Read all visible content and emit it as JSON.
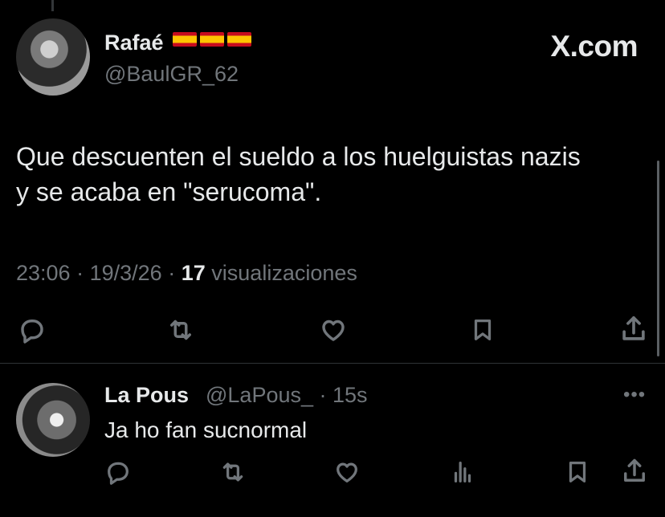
{
  "tweet": {
    "author_name": "Rafaé",
    "author_flags": [
      "🇪🇸",
      "🇪🇸",
      "🇪🇸"
    ],
    "author_handle": "@BaulGR_62",
    "brand": "X.com",
    "text_line1": "Que descuenten el sueldo a los huelguistas nazis",
    "text_line2": "y se acaba en \"serucoma\".",
    "time": "23:06",
    "date": "19/3/26",
    "views_count": "17",
    "views_label": "visualizaciones",
    "sep": "·"
  },
  "actions": [
    "reply-icon",
    "retweet-icon",
    "like-icon",
    "bookmark-icon",
    "share-icon"
  ],
  "reply": {
    "author_name": "La Pous",
    "author_handle": "@LaPous_",
    "time": "· 15s",
    "more": "•••",
    "text": "Ja ho fan sucnormal",
    "actions": [
      "reply-icon",
      "retweet-icon",
      "like-icon",
      "views-icon",
      "bookmark-icon",
      "share-icon"
    ]
  }
}
